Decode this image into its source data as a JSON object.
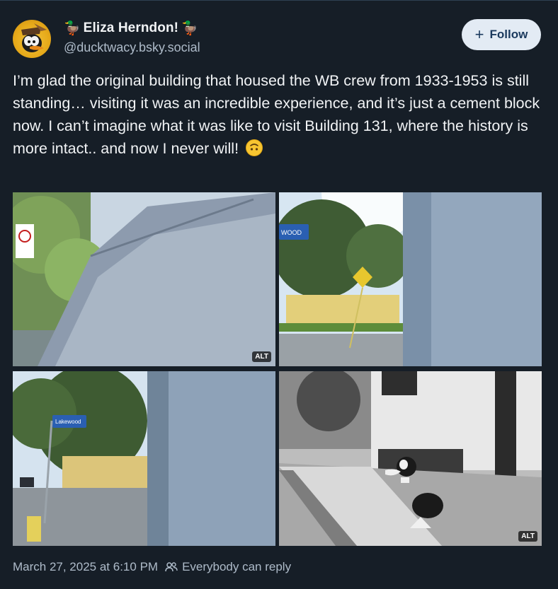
{
  "author": {
    "name_prefix_emoji": "🦆",
    "display_name": "Eliza Herndon!",
    "name_suffix_emoji": "🦆",
    "handle": "@ducktwacy.bsky.social",
    "avatar_icon": "duck-avatar-icon"
  },
  "follow_button": {
    "icon": "plus-icon",
    "label": "Follow"
  },
  "post": {
    "text": "I’m glad the original building that housed the WB crew from 1933-1953 is still standing… visiting it was an incredible experience, and it’s just a cement block now. I can’t imagine what it was like to visit Building 131, where the history is more intact.. and now I never will!",
    "emoji": "upside-down-face-icon"
  },
  "images": [
    {
      "description_icon": "building-wall-photo",
      "alt_badge": "ALT"
    },
    {
      "description_icon": "building-street-sun-photo",
      "street_sign": "WOOD"
    },
    {
      "description_icon": "building-corner-street-photo",
      "street_sign": "Lakewood"
    },
    {
      "description_icon": "vintage-photo-with-cartoon-duck",
      "alt_badge": "ALT"
    }
  ],
  "meta": {
    "timestamp": "March 27, 2025 at 6:10 PM",
    "reply_icon": "people-icon",
    "reply_setting": "Everybody can reply"
  },
  "colors": {
    "background": "#161e27",
    "text_primary": "#f1f3f5",
    "text_secondary": "#aebbc9",
    "follow_bg": "#e3ebf4",
    "follow_text": "#1b3a5e"
  }
}
